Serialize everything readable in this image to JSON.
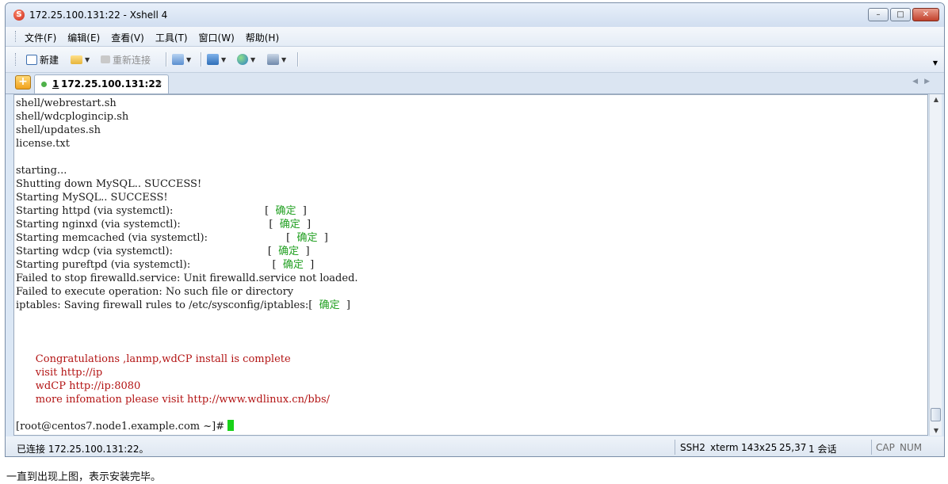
{
  "window": {
    "title": "172.25.100.131:22 - Xshell 4",
    "buttons": {
      "minimize": "–",
      "maximize": "□",
      "close": "✕"
    }
  },
  "menu": [
    "文件(F)",
    "编辑(E)",
    "查看(V)",
    "工具(T)",
    "窗口(W)",
    "帮助(H)"
  ],
  "toolbar": {
    "new_label": "新建",
    "reconnect_label": "重新连接"
  },
  "tabs": [
    {
      "number": "1",
      "label": "172.25.100.131:22",
      "close": "×"
    }
  ],
  "terminal": {
    "lines": [
      {
        "text": "shell/webrestart.sh",
        "status": "",
        "tail": "",
        "red": false
      },
      {
        "text": "shell/wdcplogincip.sh",
        "status": "",
        "tail": "",
        "red": false
      },
      {
        "text": "shell/updates.sh",
        "status": "",
        "tail": "",
        "red": false
      },
      {
        "text": "license.txt",
        "status": "",
        "tail": "",
        "red": false
      },
      {
        "text": "",
        "status": "",
        "tail": "",
        "red": false
      },
      {
        "text": "starting...",
        "status": "",
        "tail": "",
        "red": false
      },
      {
        "text": "Shutting down MySQL.. SUCCESS!",
        "status": "",
        "tail": "",
        "red": false
      },
      {
        "text": "Starting MySQL.. SUCCESS!",
        "status": "",
        "tail": "",
        "red": false
      },
      {
        "text": "Starting httpd (via systemctl):                            [  ",
        "status": "确定",
        "tail": "  ]",
        "red": false
      },
      {
        "text": "Starting nginxd (via systemctl):                           [  ",
        "status": "确定",
        "tail": "  ]",
        "red": false
      },
      {
        "text": "Starting memcached (via systemctl):                        [  ",
        "status": "确定",
        "tail": "  ]",
        "red": false
      },
      {
        "text": "Starting wdcp (via systemctl):                             [  ",
        "status": "确定",
        "tail": "  ]",
        "red": false
      },
      {
        "text": "Starting pureftpd (via systemctl):                         [  ",
        "status": "确定",
        "tail": "  ]",
        "red": false
      },
      {
        "text": "Failed to stop firewalld.service: Unit firewalld.service not loaded.",
        "status": "",
        "tail": "",
        "red": false
      },
      {
        "text": "Failed to execute operation: No such file or directory",
        "status": "",
        "tail": "",
        "red": false
      },
      {
        "text": "iptables: Saving firewall rules to /etc/sysconfig/iptables:[  ",
        "status": "确定",
        "tail": "  ]",
        "red": false
      },
      {
        "text": "",
        "status": "",
        "tail": "",
        "red": false
      },
      {
        "text": "",
        "status": "",
        "tail": "",
        "red": false
      },
      {
        "text": "",
        "status": "",
        "tail": "",
        "red": false
      },
      {
        "text": "      Congratulations ,lanmp,wdCP install is complete",
        "status": "",
        "tail": "",
        "red": true
      },
      {
        "text": "      visit http://ip",
        "status": "",
        "tail": "",
        "red": true
      },
      {
        "text": "      wdCP http://ip:8080",
        "status": "",
        "tail": "",
        "red": true
      },
      {
        "text": "      more infomation please visit http://www.wdlinux.cn/bbs/",
        "status": "",
        "tail": "",
        "red": true
      },
      {
        "text": "",
        "status": "",
        "tail": "",
        "red": false
      },
      {
        "text": "[root@centos7.node1.example.com ~]# ",
        "status": "",
        "tail": "",
        "red": false,
        "cursor": true
      }
    ]
  },
  "status": {
    "connection": "已连接 172.25.100.131:22。",
    "protocol": "SSH2",
    "term": "xterm",
    "size": "143x25",
    "cursor_pos": "25,37",
    "sessions": "1 会话",
    "cap": "CAP",
    "num": "NUM"
  },
  "caption": "一直到出现上图，表示安装完毕。"
}
